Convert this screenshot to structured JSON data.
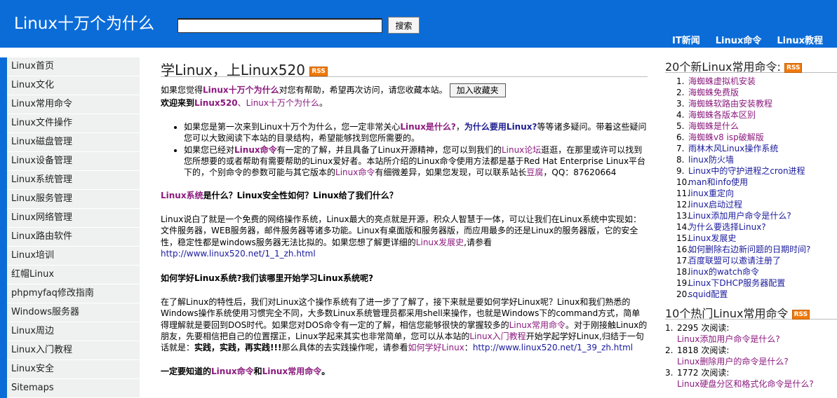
{
  "header": {
    "site_title": "Linux十万个为什么",
    "search_value": "",
    "search_button": "搜索",
    "nav": [
      "IT新闻",
      "Linux命令",
      "Linux教程"
    ]
  },
  "sidebar": {
    "items": [
      "Linux首页",
      "Linux文化",
      "Linux常用命令",
      "Linux文件操作",
      "Linux磁盘管理",
      "Linux设备管理",
      "Linux系统管理",
      "Linux服务管理",
      "Linux网络管理",
      "Linux路由软件",
      "Linux培训",
      "红帽Linux",
      "phpmyfaq修改指南",
      "Windows服务器",
      "Linux周边",
      "Linux入门教程",
      "Linux安全",
      "Sitemaps"
    ]
  },
  "main": {
    "title": "学Linux，上Linux520",
    "rss": "RSS",
    "intro_pre": "如果您觉得",
    "intro_site": "Linux十万个为什么",
    "intro_post": "对您有帮助，希望再次访问，请您收藏本站。",
    "fav_button": "加入收藏夹",
    "welcome_pre": "欢迎来到",
    "welcome_link1": "Linux520",
    "welcome_sep": "、",
    "welcome_link2": "Linux十万个为什么",
    "welcome_end": "。",
    "b1_pre": "如果您是第一次来到Linux十万个为什么，您一定非常关心",
    "b1_q1": "Linux是什么?",
    "b1_mid": "，",
    "b1_q2": "为什么要用Linux?",
    "b1_post": "等等诸多疑问。带着这些疑问您可以大致阅读下本站的目录结构，希望能够找到您所需要的。",
    "b2_pre": "如果您已经对",
    "b2_cmd": "Linux命令",
    "b2_a": "有一定的了解，并且具备了Linux开源精神，您可以到我们的",
    "b2_forum": "Linux论坛",
    "b2_b": "逛逛，在那里或许可以找到您所想要的或者帮助有需要帮助的Linux爱好者。本站所介绍的Linux命令使用方法都是基于Red Hat Enterprise Linux平台下的，个别命令的参数可能与其它版本的",
    "b2_cmd2": "Linux命令",
    "b2_c": "有细微差异，如果您发现，可以联系站长",
    "b2_admin": "豆腐",
    "b2_qq": "，QQ：87620664",
    "s1_link": "Linux系统",
    "s1_rest": "是什么？Linux安全性如何？Linux给了我们什么？",
    "p1_a": "Linux说白了就是一个免费的网络操作系统，Linux最大的亮点就是开源，积众人智慧于一体，可以让我们在Linux系统中实现如：文件服务器，WEB服务器，邮件服务器等诸多功能。Linux有桌面版和服务器版，而应用最多的还是Linux的服务器版，它的安全性，稳定性都是windows服务器无法比拟的。如果您想了解更详细的",
    "p1_link": "Linux发展史",
    "p1_b": ",请参看",
    "p1_url": "http://www.linux520.net/1_1_zh.html",
    "s2": "如何学好Linux系统?我们该哪里开始学习Linux系统呢?",
    "p2_a": "在了解Linux的特性后，我们对Linux这个操作系统有了进一步了了解了，接下来就是要如何学好Linux呢？Linux和我们熟悉的Windows操作系统使用习惯完全不同，大多数Linux系统管理员都采用shell来操作，也就是Windows下的command方式，简单得理解就是要回到DOS时代。如果您对DOS命令有一定的了解，相信您能够很快的掌握较多的",
    "p2_link1": "Linux常用命令",
    "p2_b": "。对于刚接触Linux的朋友，先要相信把自己的位置摆正，Linux学起来其实也非常简单，您可以从本站的",
    "p2_link2": "Linux入门教程",
    "p2_c": "开始学起学好Linux,归结于一句话就是：",
    "p2_bold": "实践，实践，再实践!!!",
    "p2_d": "那么具体的去实践操作呢，请参看",
    "p2_link3": "如何学好Linux",
    "p2_e": "：",
    "p2_url": "http://www.linux520.net/1_39_zh.html",
    "s3_pre": "一定要知道的",
    "s3_l1": "Linux命令",
    "s3_mid": "和",
    "s3_l2": "Linux常用命令",
    "s3_end": "。"
  },
  "right": {
    "new_title": "20个新Linux常用命令:",
    "rss": "RSS",
    "new_items": [
      "海蜘蛛虚拟机安装",
      "海蜘蛛免费版",
      "海蜘蛛软路由安装教程",
      "海蜘蛛各版本区别",
      "海蜘蛛是什么",
      "海蜘蛛v8 isp破解版",
      "雨林木风Linux操作系统",
      "linux防火墙",
      "Linux中的守护进程之cron进程",
      "man和info使用",
      "linux重定向",
      "linux启动过程",
      "Linux添加用户命令是什么?",
      "为什么要选择Linux?",
      "Linux发展史",
      "如何删除右边新问题的日期时间?",
      "百度联盟可以邀请注册了",
      "linux的watch命令",
      "Linux下DHCP服务器配置",
      "squid配置"
    ],
    "new_numbers": [
      "1.",
      "2.",
      "3.",
      "4.",
      "5.",
      "6.",
      "7.",
      "8.",
      "9.",
      "10.",
      "11.",
      "12.",
      "13.",
      "14.",
      "15.",
      "16.",
      "17.",
      "18.",
      "19.",
      "20."
    ],
    "hot_title": "10个热门Linux常用命令",
    "hot_items": [
      {
        "num": "1.",
        "reads": "2295 次阅读:",
        "title": "Linux添加用户命令是什么?"
      },
      {
        "num": "2.",
        "reads": "1818 次阅读:",
        "title": "Linux删除用户的命令是什么?"
      },
      {
        "num": "3.",
        "reads": "1772 次阅读:",
        "title": "Linux硬盘分区和格式化命令是什么?"
      }
    ]
  },
  "colors": {
    "header": "#0b6cd8",
    "link_purple": "#8b1a7e",
    "link_blue": "#1a1a9c",
    "rss": "#ef7a0e",
    "sidebar_bg": "#eef1ef"
  }
}
